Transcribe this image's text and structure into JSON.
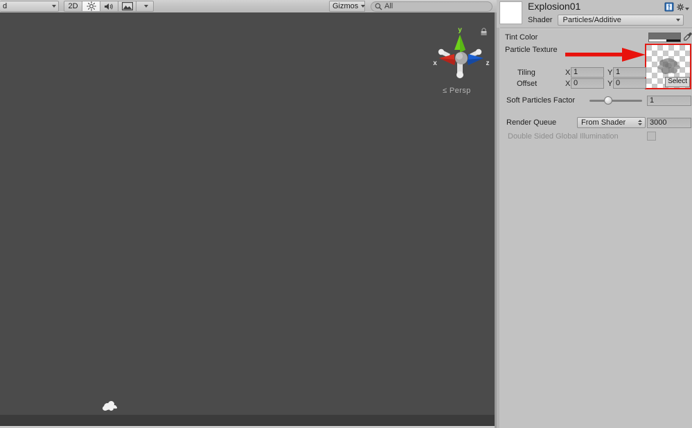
{
  "scene": {
    "toolbar": {
      "draw_mode": "d",
      "mode_2d": "2D",
      "lighting_icon": "sun-icon",
      "audio_icon": "speaker-icon",
      "fx_icon": "image-effects-icon",
      "gizmos": "Gizmos",
      "search_placeholder": "All",
      "search_value": "All",
      "search_icon": "search-icon"
    },
    "gizmo": {
      "x_label": "x",
      "y_label": "y",
      "z_label": "z",
      "perspective_label": "Persp",
      "perspective_prefix": "≤",
      "lock_icon": "lock-icon",
      "colors": {
        "x_axis": "#d62d20",
        "y_axis": "#6fd11b",
        "z_axis": "#1b5fd1",
        "neutral": "#d9d9d9",
        "center": "#a9a9a9"
      }
    },
    "viewport": {
      "background_color": "#4b4b4b",
      "particle_name": "explosion-particle"
    }
  },
  "inspector": {
    "material_name": "Explosion01",
    "preview_icon": "material-preview",
    "help_icon": "help-book-icon",
    "gear_icon": "gear-icon",
    "shader": {
      "label": "Shader",
      "value": "Particles/Additive"
    },
    "properties": {
      "tint_color": {
        "label": "Tint Color",
        "swatch_color": "#6e6e6e",
        "eyedropper_icon": "eyedropper-icon"
      },
      "particle_texture": {
        "label": "Particle Texture",
        "select_button": "Select",
        "highlight_color": "#e01b15"
      },
      "tiling": {
        "label": "Tiling",
        "x_label": "X",
        "x_value": "1",
        "y_label": "Y",
        "y_value": "1"
      },
      "offset": {
        "label": "Offset",
        "x_label": "X",
        "x_value": "0",
        "y_label": "Y",
        "y_value": "0"
      },
      "soft_particles_factor": {
        "label": "Soft Particles Factor",
        "value": "1",
        "slider_percent": 40
      },
      "render_queue": {
        "label": "Render Queue",
        "mode": "From Shader",
        "value": "3000"
      },
      "double_sided_gi": {
        "label": "Double Sided Global Illumination",
        "checked": false,
        "disabled": true
      }
    }
  },
  "annotation": {
    "arrow_color": "#e8120c",
    "arrow_name": "red-pointer-arrow"
  }
}
